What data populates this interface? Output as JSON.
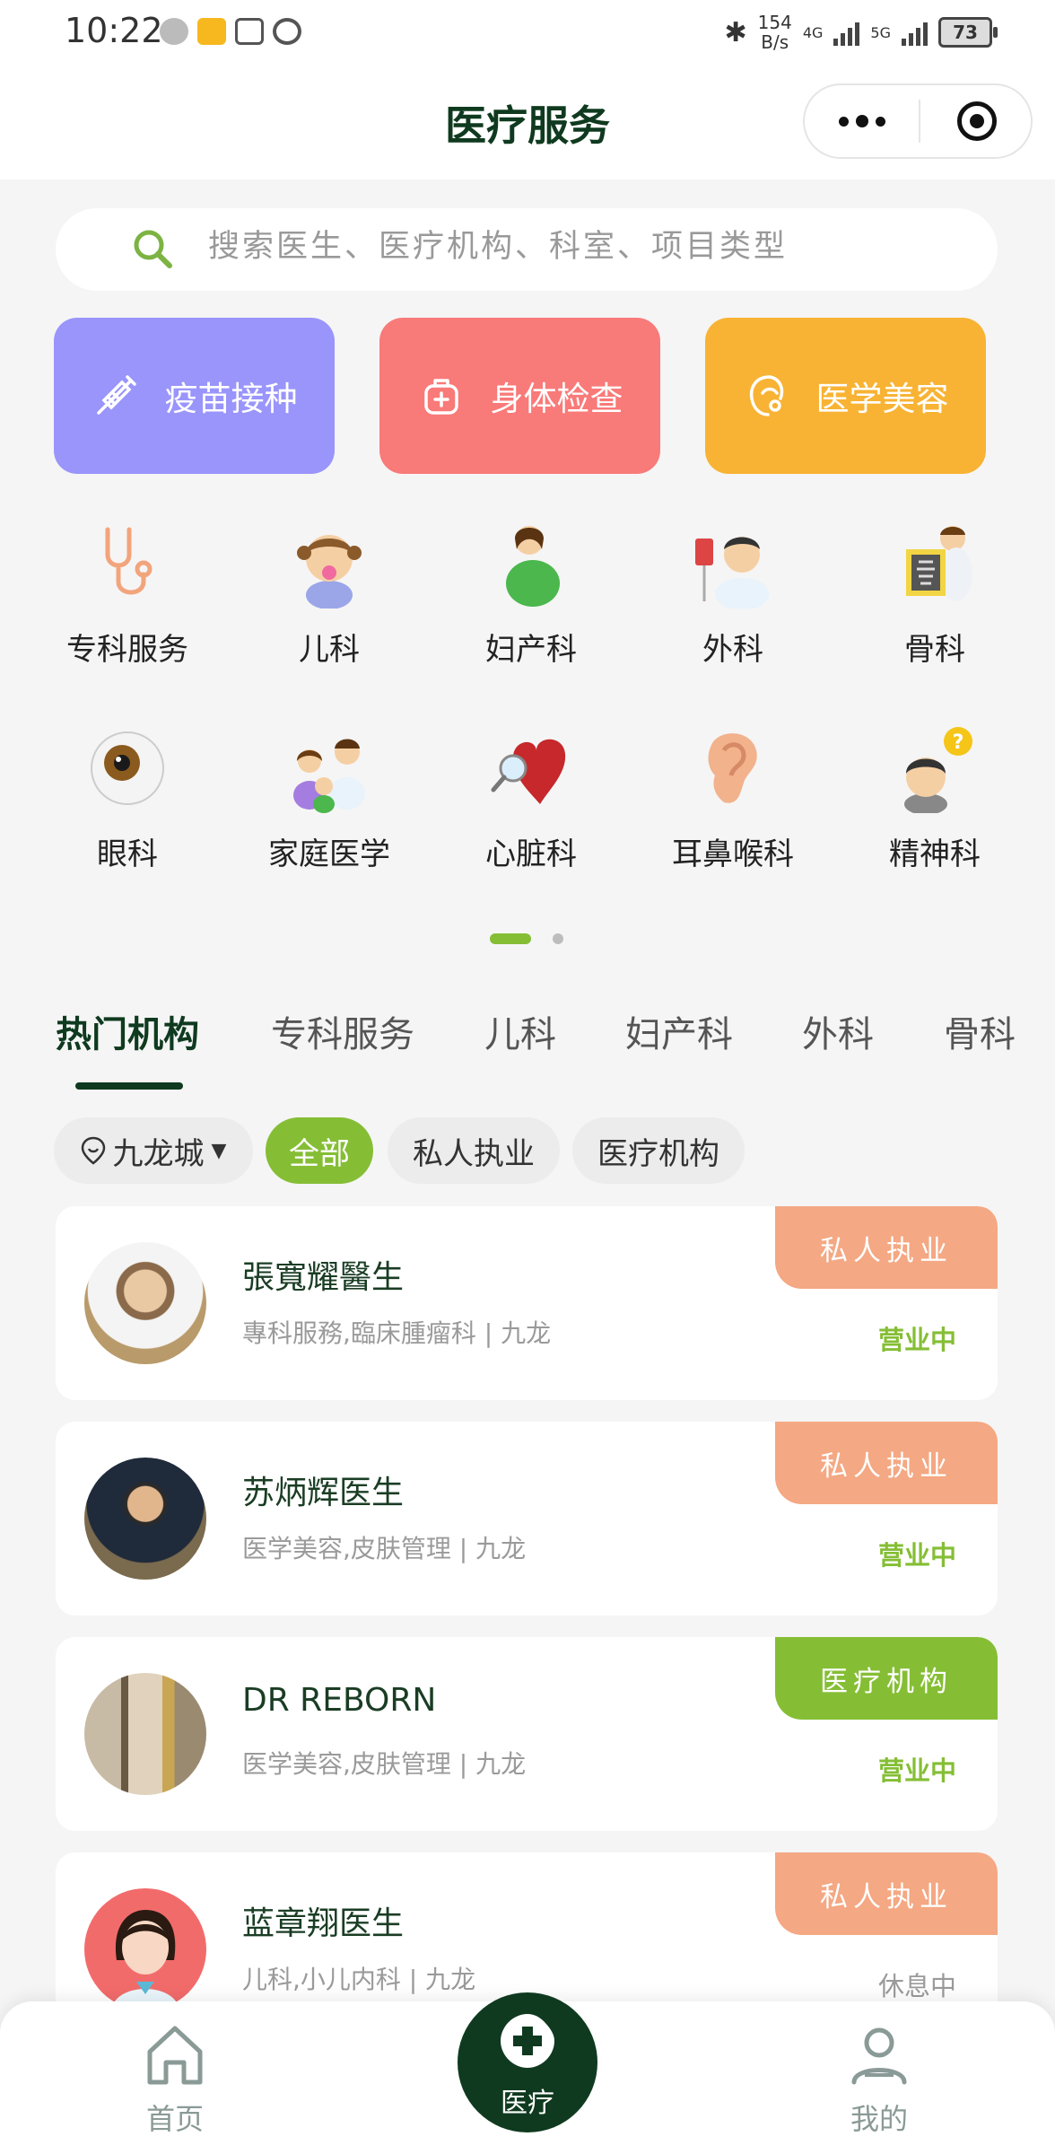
{
  "status_bar": {
    "time": "10:22",
    "net_speed_value": "154",
    "net_speed_unit": "B/s",
    "signal_1": "4G",
    "signal_2": "5G",
    "battery": "73"
  },
  "header": {
    "title": "医疗服务"
  },
  "search": {
    "placeholder": "搜索医生、医疗机构、科室、项目类型"
  },
  "services": [
    {
      "label": "疫苗接种",
      "color": "#9a95fb"
    },
    {
      "label": "身体检查",
      "color": "#f87a79"
    },
    {
      "label": "医学美容",
      "color": "#f8b334"
    }
  ],
  "categories": [
    {
      "label": "专科服务",
      "icon": "stethoscope-icon"
    },
    {
      "label": "儿科",
      "icon": "child-icon"
    },
    {
      "label": "妇产科",
      "icon": "pregnant-woman-icon"
    },
    {
      "label": "外科",
      "icon": "surgeon-icon"
    },
    {
      "label": "骨科",
      "icon": "xray-icon"
    },
    {
      "label": "眼科",
      "icon": "eye-icon"
    },
    {
      "label": "家庭医学",
      "icon": "family-icon"
    },
    {
      "label": "心脏科",
      "icon": "heart-icon"
    },
    {
      "label": "耳鼻喉科",
      "icon": "ear-icon"
    },
    {
      "label": "精神科",
      "icon": "question-head-icon"
    }
  ],
  "tabs": [
    "热门机构",
    "专科服务",
    "儿科",
    "妇产科",
    "外科",
    "骨科"
  ],
  "filters": {
    "location": "九龙城",
    "chips": [
      "全部",
      "私人执业",
      "医疗机构"
    ]
  },
  "institutions": [
    {
      "name": "張寬耀醫生",
      "subtitle": "專科服務,臨床腫瘤科 | 九龙",
      "badge": "私人执业",
      "status": "营业中"
    },
    {
      "name": "苏炳辉医生",
      "subtitle": "医学美容,皮肤管理 | 九龙",
      "badge": "私人执业",
      "status": "营业中"
    },
    {
      "name": "DR REBORN",
      "subtitle": "医学美容,皮肤管理 | 九龙",
      "badge": "医疗机构",
      "status": "营业中"
    },
    {
      "name": "蓝章翔医生",
      "subtitle": "儿科,小儿内科 | 九龙",
      "badge": "私人执业",
      "status": "休息中"
    }
  ],
  "colors": {
    "brand_dark": "#0f3a1f",
    "accent_green": "#85be35",
    "badge_private": "#f4a883",
    "badge_institution": "#85be35",
    "status_open": "#85be35",
    "status_closed": "#9a9a9a"
  },
  "bottom_nav": {
    "home": "首页",
    "medical": "医疗",
    "mine": "我的"
  }
}
